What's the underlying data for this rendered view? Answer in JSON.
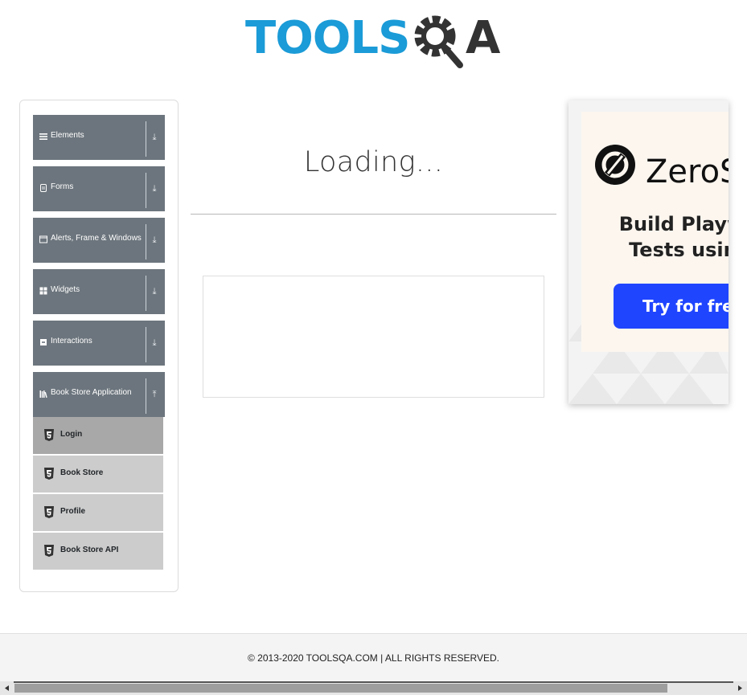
{
  "header": {
    "logo_text_left": "TOOLS",
    "logo_text_right": "A"
  },
  "sidebar": {
    "groups": [
      {
        "label": "Elements",
        "icon": "hamburger-icon",
        "state": "collapsed"
      },
      {
        "label": "Forms",
        "icon": "file-icon",
        "state": "collapsed"
      },
      {
        "label": "Alerts, Frame & Windows",
        "icon": "window-icon",
        "state": "collapsed"
      },
      {
        "label": "Widgets",
        "icon": "grid-icon",
        "state": "collapsed"
      },
      {
        "label": "Interactions",
        "icon": "square-icon",
        "state": "collapsed"
      },
      {
        "label": "Book Store Application",
        "icon": "library-icon",
        "state": "expanded"
      }
    ],
    "items": [
      {
        "label": "Login",
        "icon": "html5-icon",
        "active": true
      },
      {
        "label": "Book Store",
        "icon": "html5-icon",
        "active": false
      },
      {
        "label": "Profile",
        "icon": "html5-icon",
        "active": false
      },
      {
        "label": "Book Store API",
        "icon": "html5-icon",
        "active": false
      }
    ]
  },
  "main": {
    "title": "Loading..."
  },
  "ad": {
    "brand": "ZeroSt",
    "line1": "Build Playwri",
    "line2": "Tests using",
    "button": "Try for free -",
    "button_color": "#1f45ff"
  },
  "footer": {
    "text": "© 2013-2020 TOOLSQA.COM | ALL RIGHTS RESERVED."
  },
  "colors": {
    "sidebar_group_bg": "#6c757d",
    "menu_item_bg": "#cccccc",
    "menu_item_active_bg": "#a8a8a8",
    "logo_blue": "#1b9bd7",
    "logo_dark": "#3a3a3a"
  }
}
